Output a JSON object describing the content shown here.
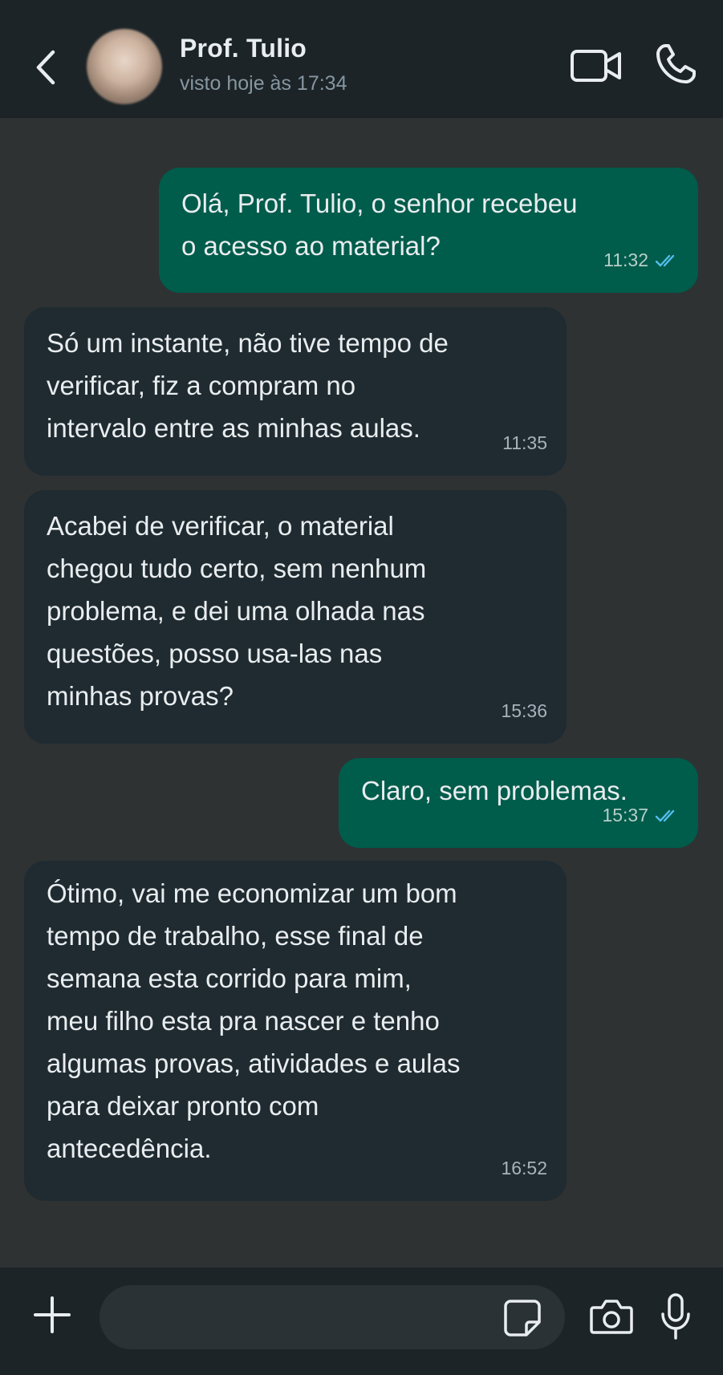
{
  "header": {
    "contact_name": "Prof. Tulio",
    "status": "visto hoje às 17:34",
    "icons": {
      "back": "chevron-left-icon",
      "video": "video-camera-icon",
      "call": "phone-icon"
    }
  },
  "messages": [
    {
      "direction": "out",
      "text": "Olá, Prof. Tulio, o senhor recebeu\no acesso ao material?",
      "time": "11:32",
      "read": true
    },
    {
      "direction": "in",
      "text": "Só um instante, não tive tempo de\nverificar, fiz a compram no\nintervalo entre as minhas aulas.",
      "time": "11:35"
    },
    {
      "direction": "in",
      "text": "Acabei de verificar, o material\nchegou tudo certo, sem nenhum\nproblema, e dei uma olhada nas\nquestões, posso usa-las nas\nminhas provas?",
      "time": "15:36"
    },
    {
      "direction": "out",
      "text": "Claro, sem problemas.",
      "time": "15:37",
      "read": true
    },
    {
      "direction": "in",
      "text": "Ótimo, vai me economizar um bom\ntempo de trabalho, esse final de\nsemana esta corrido para mim,\nmeu filho esta pra nascer e tenho\nalgumas provas, atividades e aulas\npara deixar pronto com\nantecedência.",
      "time": "16:52"
    }
  ],
  "composer": {
    "value": "",
    "icons": {
      "attach": "plus-icon",
      "sticker": "sticker-icon",
      "camera": "camera-icon",
      "mic": "microphone-icon"
    }
  },
  "colors": {
    "header_bg": "#1c2428",
    "chat_bg": "#2e3233",
    "incoming_bubble": "#1f2b31",
    "outgoing_bubble": "#005c4b",
    "read_receipt": "#53bdeb"
  }
}
